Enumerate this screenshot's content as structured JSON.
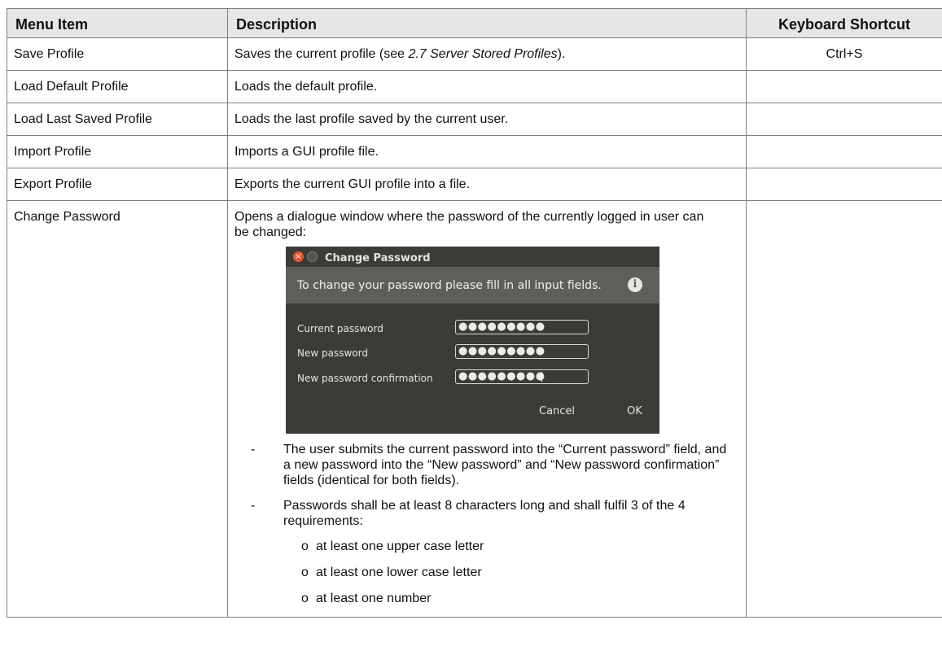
{
  "headers": {
    "menu_item": "Menu Item",
    "description": "Description",
    "shortcut": "Keyboard Shortcut"
  },
  "rows": [
    {
      "item": "Save Profile",
      "desc_pre": "Saves the current profile (see ",
      "desc_ref": "2.7 Server Stored Profiles",
      "desc_post": ").",
      "shortcut": "Ctrl+S"
    },
    {
      "item": "Load Default Profile",
      "desc": "Loads the default profile.",
      "shortcut": ""
    },
    {
      "item": "Load Last Saved Profile",
      "desc": "Loads the last profile saved by the current user.",
      "shortcut": ""
    },
    {
      "item": "Import Profile",
      "desc": "Imports a GUI profile file.",
      "shortcut": ""
    },
    {
      "item": "Export Profile",
      "desc": "Exports the current GUI profile into a file.",
      "shortcut": ""
    },
    {
      "item": "Change Password",
      "desc": "Opens a dialogue window where the password of the currently logged in user can be changed:",
      "shortcut": ""
    }
  ],
  "dialog": {
    "title": "Change Password",
    "info_text": "To change your password please fill in all input fields.",
    "fields": [
      {
        "label": "Current password",
        "value": "●●●●●●●●●"
      },
      {
        "label": "New password",
        "value": "●●●●●●●●●"
      },
      {
        "label": "New password confirmation",
        "value": "●●●●●●●●●"
      }
    ],
    "cancel_label": "Cancel",
    "ok_label": "OK",
    "close_icon": "close-icon",
    "info_icon": "info-icon"
  },
  "bullets": [
    "The user submits the current password into the “Current password” field, and a new password into the “New password” and “New password confirmation” fields (identical for both fields).",
    "Passwords shall be at least 8 characters long and shall fulfil 3 of the 4 requirements:"
  ],
  "dash_mark": "-",
  "circle_mark": "o",
  "requirements": [
    "at least one upper case letter",
    "at least one lower case letter",
    "at least one number"
  ]
}
